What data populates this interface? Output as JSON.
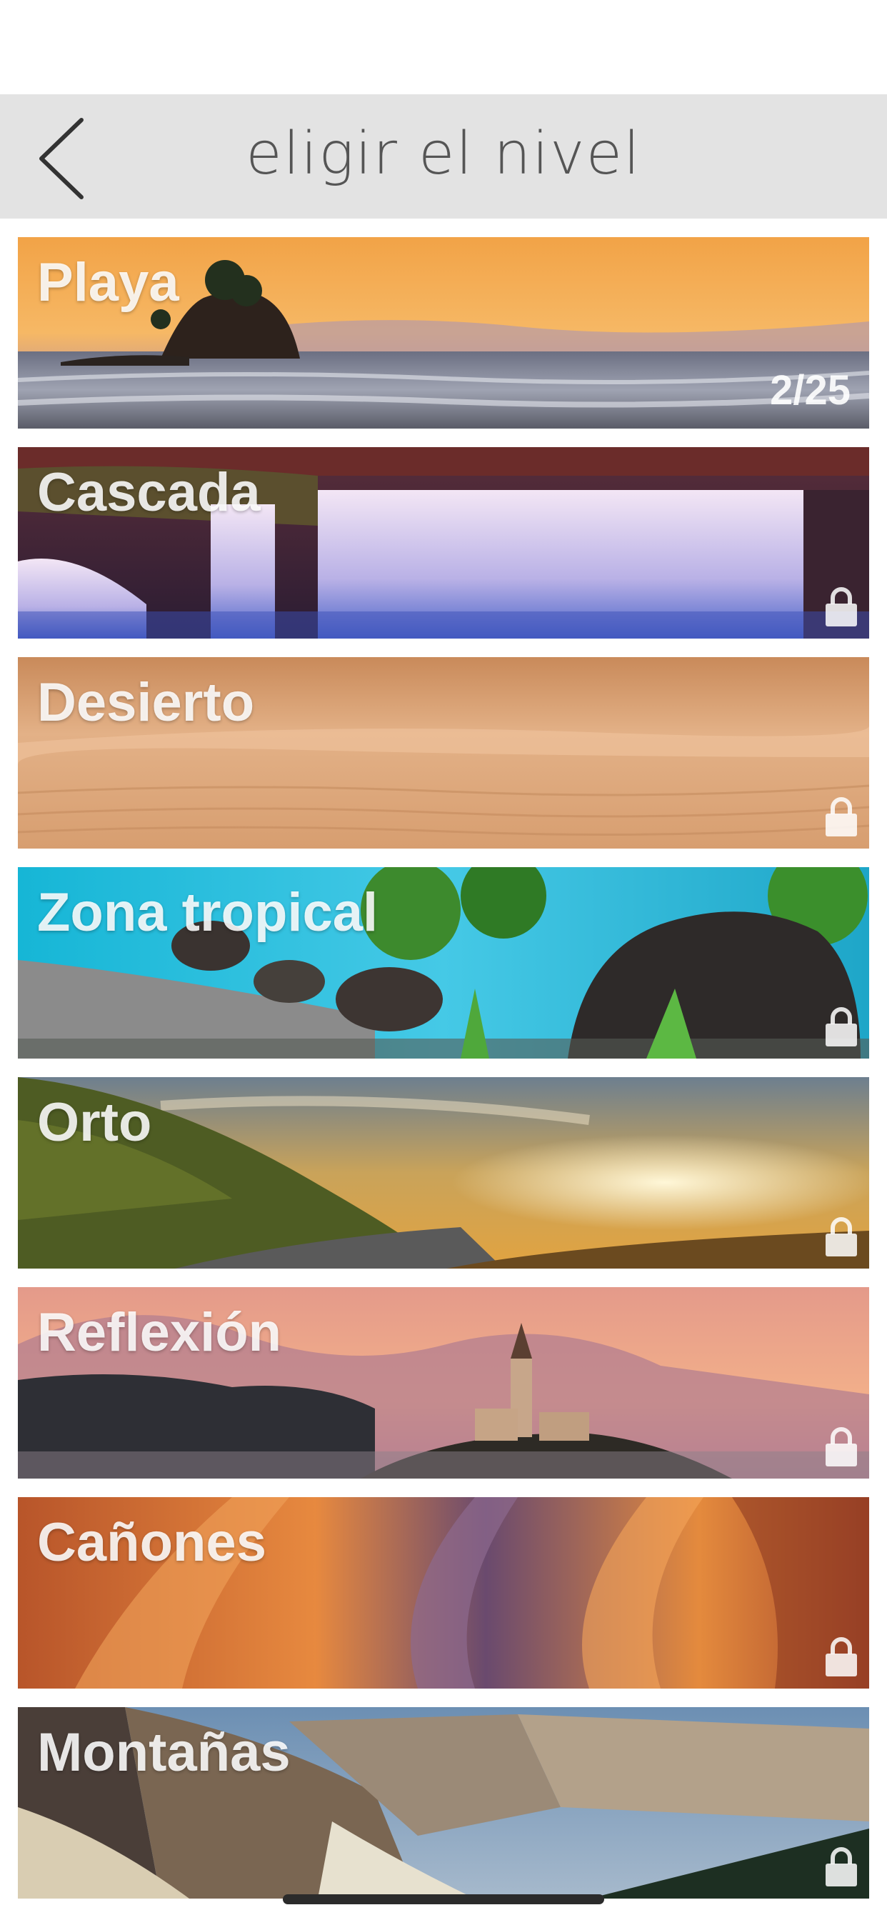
{
  "header": {
    "title": "eligir el nivel",
    "back_icon": "chevron-left-icon"
  },
  "levels": [
    {
      "name": "Playa",
      "progress": "2/25",
      "locked": false
    },
    {
      "name": "Cascada",
      "locked": true,
      "lock_icon": "lock-icon"
    },
    {
      "name": "Desierto",
      "locked": true,
      "lock_icon": "lock-icon"
    },
    {
      "name": "Zona tropical",
      "locked": true,
      "lock_icon": "lock-icon"
    },
    {
      "name": "Orto",
      "locked": true,
      "lock_icon": "lock-icon"
    },
    {
      "name": "Reflexión",
      "locked": true,
      "lock_icon": "lock-icon"
    },
    {
      "name": "Cañones",
      "locked": true,
      "lock_icon": "lock-icon"
    },
    {
      "name": "Montañas",
      "locked": true,
      "lock_icon": "lock-icon"
    }
  ],
  "colors": {
    "header_bg": "#e3e3e3",
    "title_text": "#555555",
    "label_text": "#ffffff"
  }
}
